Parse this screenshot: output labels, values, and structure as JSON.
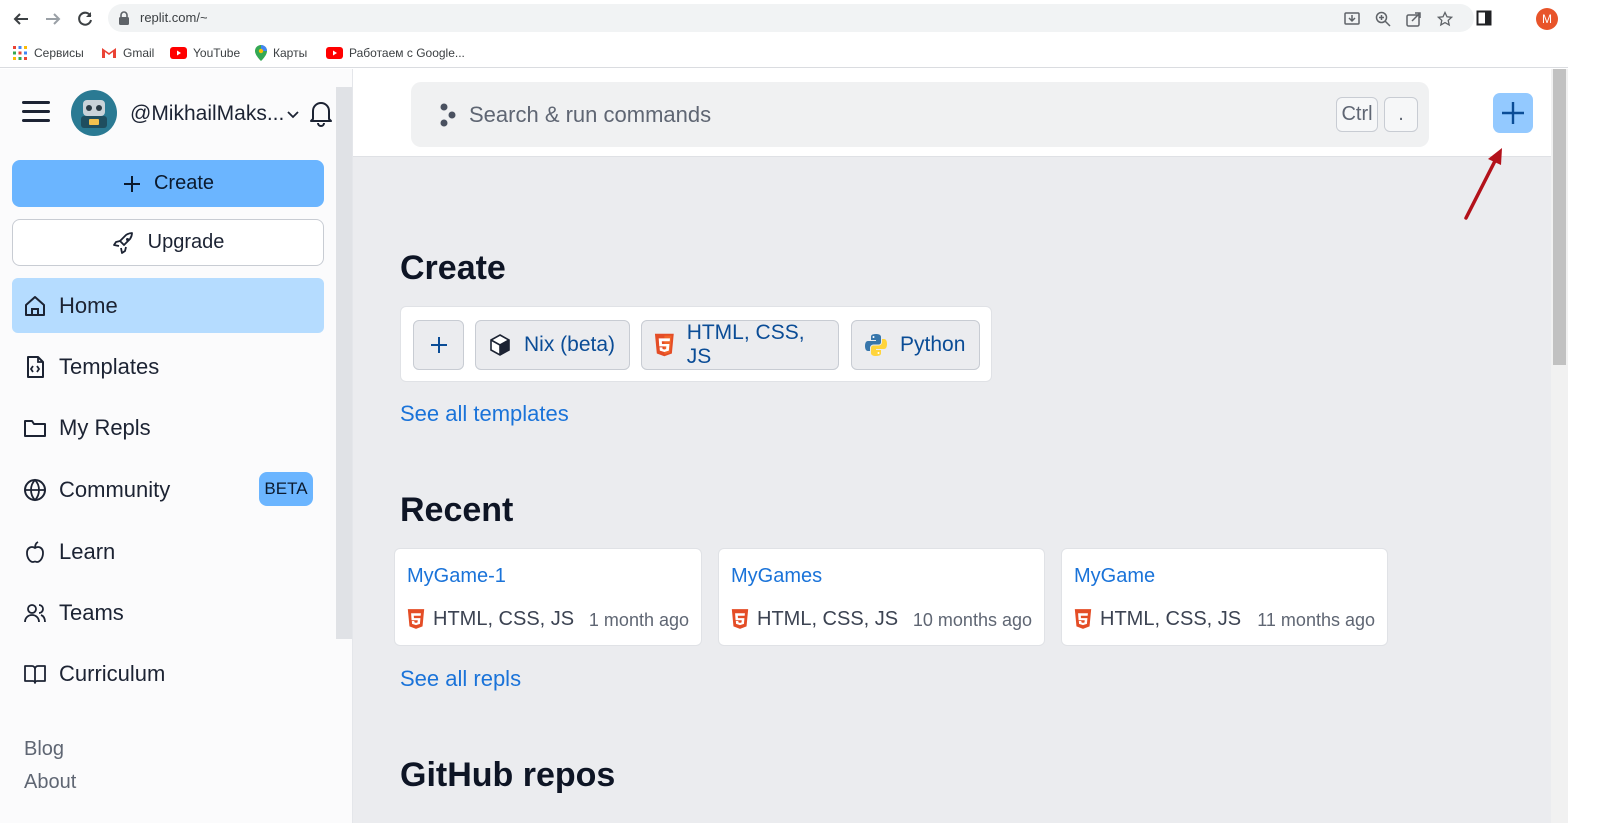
{
  "browser": {
    "url": "replit.com/~",
    "profile_initial": "M",
    "bookmarks": [
      {
        "label": "Сервисы",
        "icon": "apps-grid-icon"
      },
      {
        "label": "Gmail",
        "icon": "gmail-icon"
      },
      {
        "label": "YouTube",
        "icon": "youtube-icon"
      },
      {
        "label": "Карты",
        "icon": "maps-pin-icon"
      },
      {
        "label": "Работаем с Google...",
        "icon": "youtube-icon"
      }
    ]
  },
  "sidebar": {
    "username": "@MikhailMaks...",
    "create_label": "Create",
    "upgrade_label": "Upgrade",
    "items": [
      {
        "label": "Home",
        "icon": "home-icon",
        "active": true
      },
      {
        "label": "Templates",
        "icon": "file-code-icon"
      },
      {
        "label": "My Repls",
        "icon": "folder-icon"
      },
      {
        "label": "Community",
        "icon": "globe-icon",
        "badge": "BETA"
      },
      {
        "label": "Learn",
        "icon": "apple-icon"
      },
      {
        "label": "Teams",
        "icon": "users-icon"
      },
      {
        "label": "Curriculum",
        "icon": "book-icon"
      }
    ],
    "footer": [
      "Blog",
      "About"
    ]
  },
  "header": {
    "search_placeholder": "Search & run commands",
    "shortcut_keys": [
      "Ctrl",
      "."
    ]
  },
  "main": {
    "create_heading": "Create",
    "templates": [
      {
        "label": "",
        "icon": "plus-icon"
      },
      {
        "label": "Nix (beta)",
        "icon": "nix-cube-icon"
      },
      {
        "label": "HTML, CSS, JS",
        "icon": "html5-icon"
      },
      {
        "label": "Python",
        "icon": "python-icon"
      }
    ],
    "see_all_templates": "See all templates",
    "recent_heading": "Recent",
    "recent": [
      {
        "title": "MyGame-1",
        "language": "HTML, CSS, JS",
        "time": "1 month ago"
      },
      {
        "title": "MyGames",
        "language": "HTML, CSS, JS",
        "time": "10 months ago"
      },
      {
        "title": "MyGame",
        "language": "HTML, CSS, JS",
        "time": "11 months ago"
      }
    ],
    "see_all_repls": "See all repls",
    "github_heading": "GitHub repos"
  },
  "colors": {
    "accent_blue": "#6bb5ff",
    "active_nav": "#b5dcff",
    "link_blue": "#1a73d9",
    "annotation_arrow": "#b3121b"
  }
}
